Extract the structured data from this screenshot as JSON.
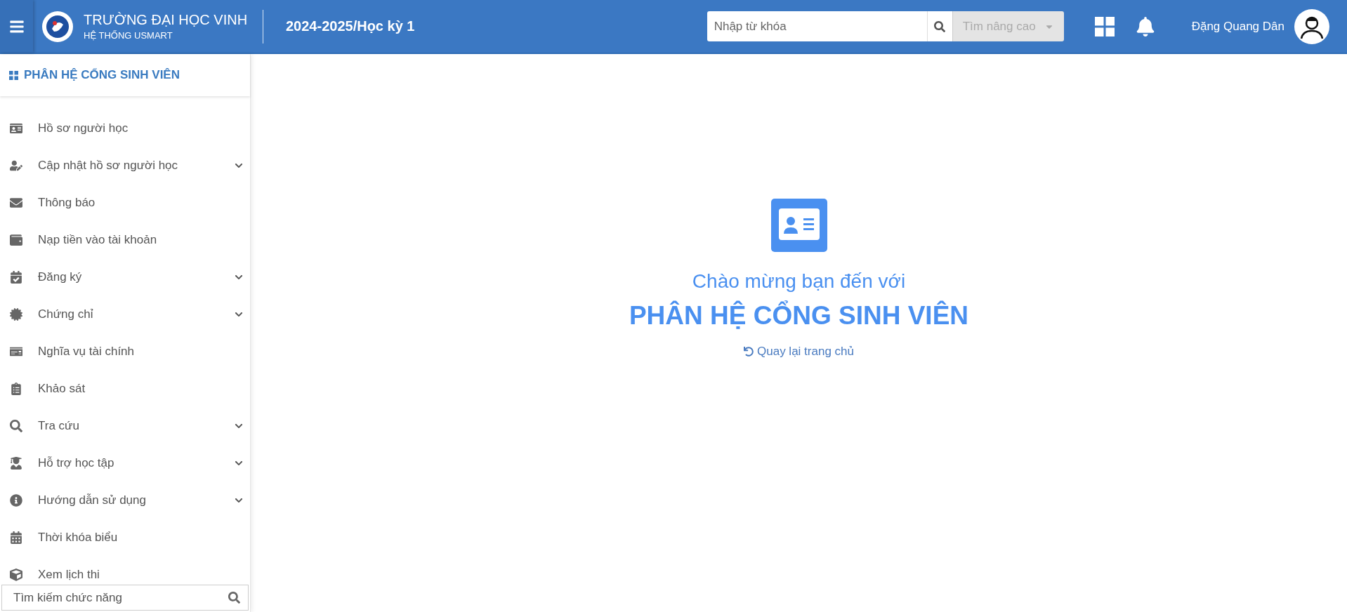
{
  "header": {
    "school_name": "TRƯỜNG ĐẠI HỌC VINH",
    "system_name": "HỆ THỐNG USMART",
    "term": "2024-2025/Học kỳ 1",
    "search": {
      "placeholder": "Nhập từ khóa"
    },
    "advanced_search": {
      "label": "Tìm nâng cao",
      "disabled": true
    },
    "user_name": "Đặng Quang Dân"
  },
  "sidebar": {
    "title": "PHÂN HỆ CỔNG SINH VIÊN",
    "items": [
      {
        "label": "Hồ sơ người học",
        "has_submenu": false
      },
      {
        "label": "Cập nhật hồ sơ người học",
        "has_submenu": true
      },
      {
        "label": "Thông báo",
        "has_submenu": false
      },
      {
        "label": "Nạp tiền vào tài khoản",
        "has_submenu": false
      },
      {
        "label": "Đăng ký",
        "has_submenu": true
      },
      {
        "label": "Chứng chỉ",
        "has_submenu": true
      },
      {
        "label": "Nghĩa vụ tài chính",
        "has_submenu": false
      },
      {
        "label": "Khảo sát",
        "has_submenu": false
      },
      {
        "label": "Tra cứu",
        "has_submenu": true
      },
      {
        "label": "Hỗ trợ học tập",
        "has_submenu": true
      },
      {
        "label": "Hướng dẫn sử dụng",
        "has_submenu": true
      },
      {
        "label": "Thời khóa biểu",
        "has_submenu": false
      },
      {
        "label": "Xem lịch thi",
        "has_submenu": false
      }
    ],
    "search": {
      "placeholder": "Tìm kiếm chức năng"
    }
  },
  "welcome": {
    "greeting": "Chào mừng bạn đến với",
    "title": "PHÂN HỆ CỔNG SINH VIÊN",
    "back_link": "Quay lại trang chủ"
  }
}
